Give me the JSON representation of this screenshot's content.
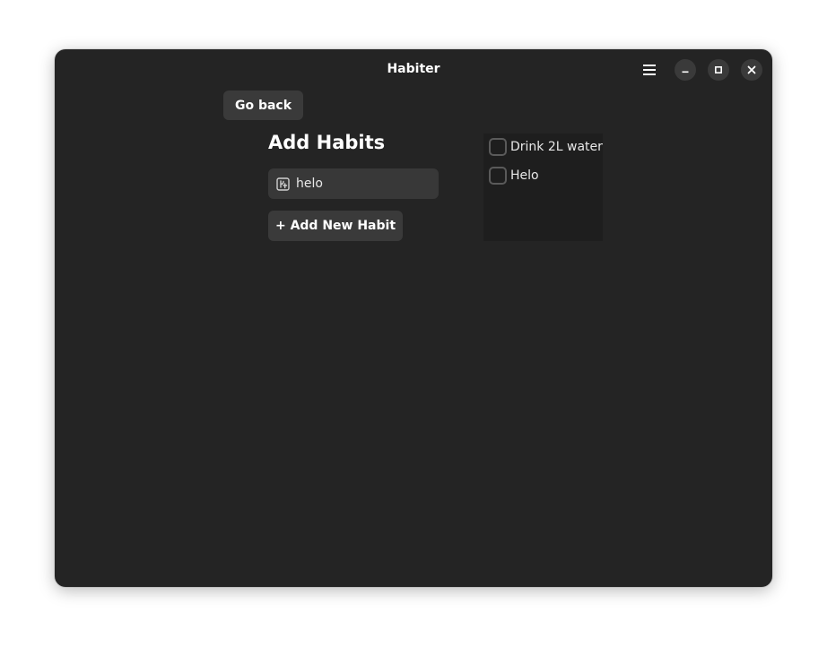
{
  "window": {
    "title": "Habiter"
  },
  "headerbar": {
    "menu_icon": "hamburger-menu-icon",
    "minimize_icon": "minimize-icon",
    "maximize_icon": "maximize-icon",
    "close_icon": "close-icon"
  },
  "navigation": {
    "go_back_label": "Go back"
  },
  "add_section": {
    "title": "Add Habits",
    "input": {
      "value": "helo",
      "icon": "emoji-picker-icon"
    },
    "add_button_label": "+ Add New Habit"
  },
  "habits": {
    "items": [
      {
        "label": "Drink 2L water",
        "checked": false
      },
      {
        "label": "Helo",
        "checked": false
      }
    ]
  },
  "colors": {
    "window_bg": "#242424",
    "button_bg": "#3a3a3a",
    "list_bg": "#1e1e1e",
    "text": "#ffffff"
  }
}
